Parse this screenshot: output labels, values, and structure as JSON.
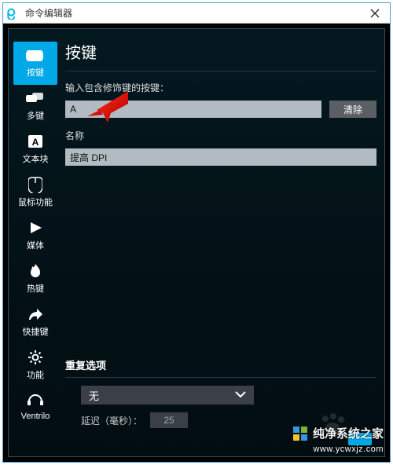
{
  "window": {
    "title": "命令编辑器"
  },
  "sidebar": {
    "items": [
      {
        "label": "按键"
      },
      {
        "label": "多键"
      },
      {
        "label": "文本块"
      },
      {
        "label": "鼠标功能"
      },
      {
        "label": "媒体"
      },
      {
        "label": "热键"
      },
      {
        "label": "快捷键"
      },
      {
        "label": "功能"
      },
      {
        "label": "Ventrilo"
      }
    ]
  },
  "main": {
    "heading": "按键",
    "input_label": "输入包含修饰键的按键：",
    "key_value": "A",
    "clear_label": "清除",
    "name_label": "名称",
    "name_value": "提高 DPI"
  },
  "repeat": {
    "title": "重复选项",
    "selected": "无",
    "delay_label": "延迟（毫秒）：",
    "delay_value": "25"
  },
  "watermark": {
    "brand": "纯净系统之家",
    "url": "www.ycwxjz.com"
  }
}
